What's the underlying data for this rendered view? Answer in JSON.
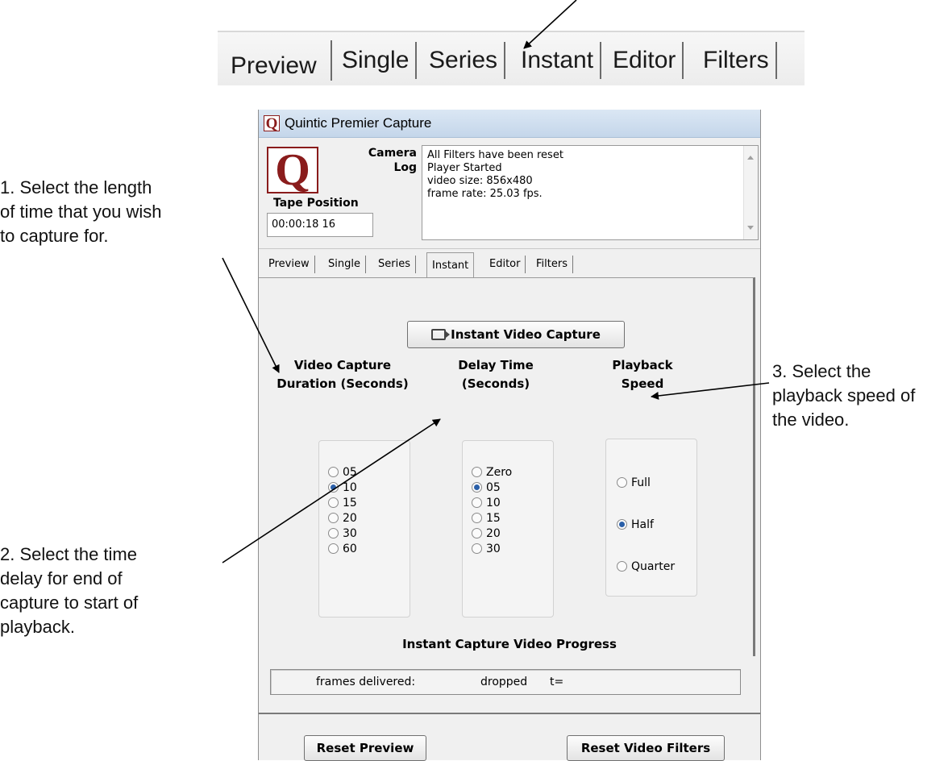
{
  "top_tabs": [
    "Preview",
    "Single",
    "Series",
    "Instant",
    "Editor",
    "Filters"
  ],
  "notes": {
    "n1": [
      "1. Select the length",
      "of time that you wish",
      "to capture for."
    ],
    "n2": [
      "2. Select the time",
      "delay for end of",
      "capture to start of",
      "playback."
    ],
    "n3": [
      "3. Select the",
      "playback speed of",
      "the video."
    ]
  },
  "window": {
    "title": "Quintic Premier Capture",
    "logo_letter": "Q",
    "camera_label": "Camera",
    "log_label": "Log",
    "tape_position_label": "Tape Position",
    "tape_position_value": "00:00:18 16",
    "log_lines": [
      "All Filters have been reset",
      "Player Started",
      "video size: 856x480",
      "frame rate: 25.03 fps."
    ],
    "tabs": [
      "Preview",
      "Single",
      "Series",
      "Instant",
      "Editor",
      "Filters"
    ],
    "active_tab": "Instant",
    "capture_button": "Instant Video Capture",
    "duration": {
      "header": [
        "Video Capture",
        "Duration (Seconds)"
      ],
      "options": [
        "05",
        "10",
        "15",
        "20",
        "30",
        "60"
      ],
      "selected": "10"
    },
    "delay": {
      "header": [
        "Delay Time",
        "(Seconds)"
      ],
      "options": [
        "Zero",
        "05",
        "10",
        "15",
        "20",
        "30"
      ],
      "selected": "05"
    },
    "playback": {
      "header": [
        "Playback",
        "Speed"
      ],
      "options": [
        "Full",
        "Half",
        "Quarter"
      ],
      "selected": "Half"
    },
    "progress_title": "Instant Capture Video Progress",
    "progress": {
      "frames": "frames delivered:",
      "dropped": "dropped",
      "t": "t="
    },
    "reset_preview": "Reset Preview",
    "reset_filters": "Reset Video Filters"
  },
  "colors": {
    "logo": "#8a1c1c",
    "radio_selected": "#2a5fa8",
    "titlebar": "#c4d6ea"
  }
}
